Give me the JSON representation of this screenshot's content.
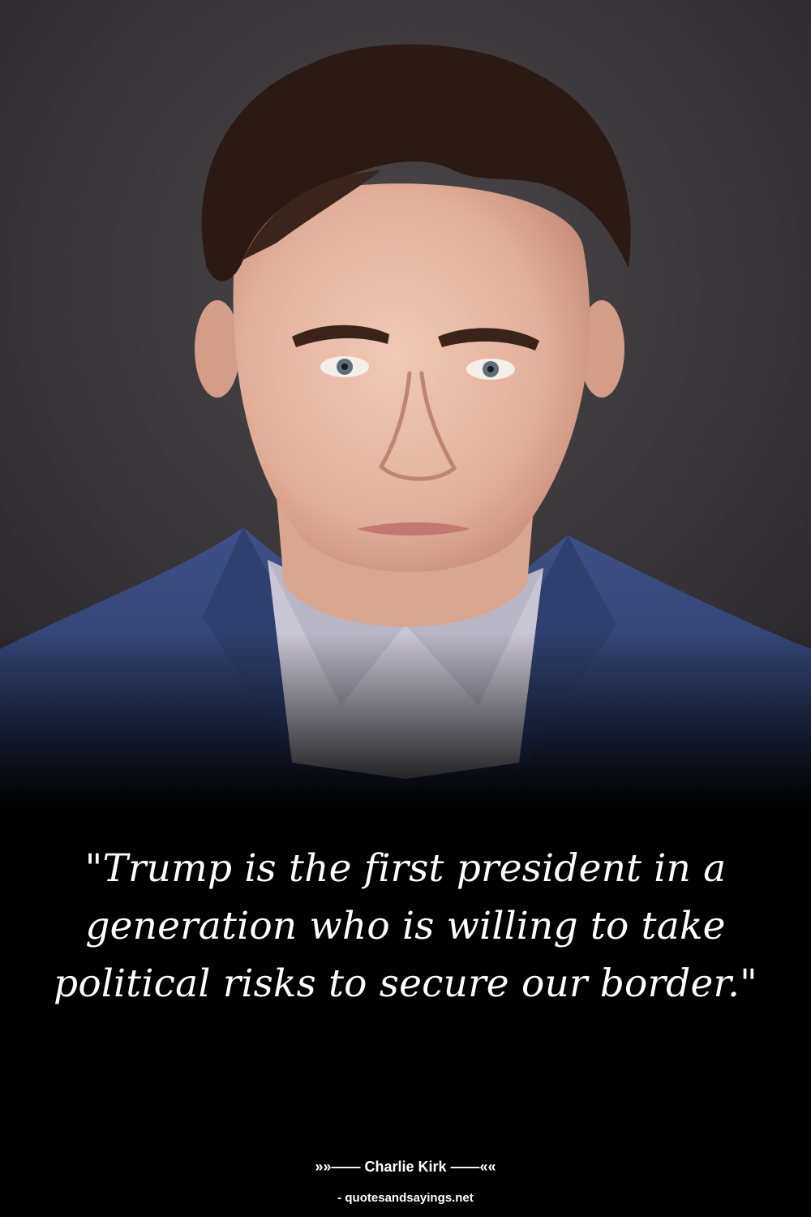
{
  "quote": {
    "text": "\"Trump is the first president in a generation who is willing to take political risks to secure our border.\""
  },
  "attribution": {
    "author_line": "»»—— Charlie Kirk ——««",
    "source_line": "- quotesandsayings.net"
  },
  "colors": {
    "background": "#000000",
    "text": "#ffffff",
    "photo_backdrop": "#3d3a3d",
    "suit": "#35467a"
  }
}
